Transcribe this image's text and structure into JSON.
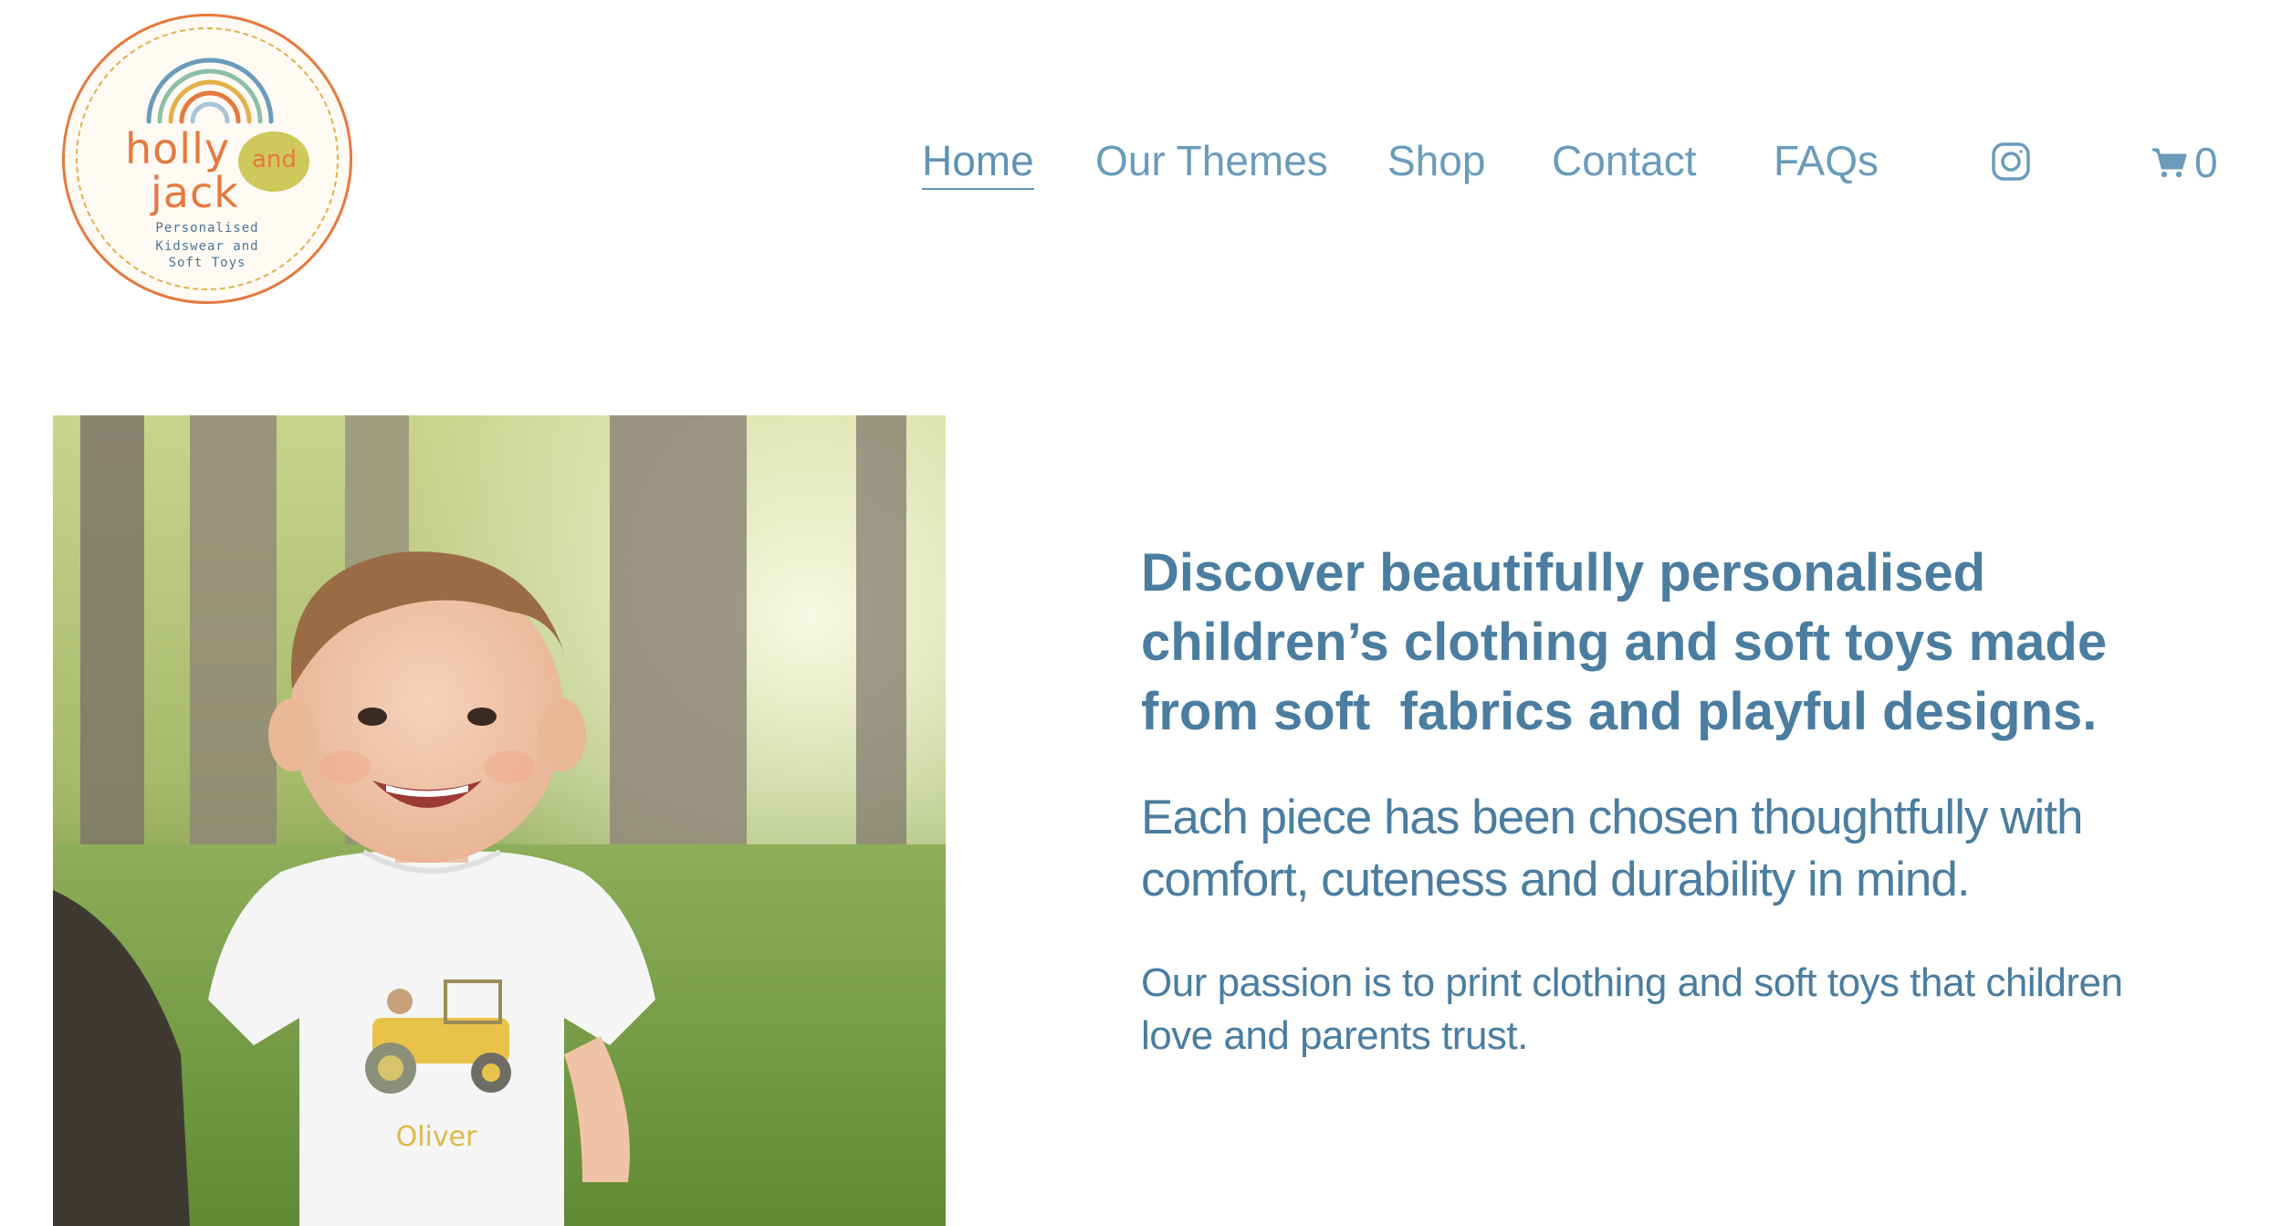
{
  "brand": {
    "logo_words": [
      "holly",
      "and",
      "jack"
    ],
    "logo_tagline": [
      "Personalised",
      "Kidswear and",
      "Soft Toys"
    ],
    "logo_colors": {
      "ring": "#e5793f",
      "dot": "#cfc85a",
      "rainbow": [
        "#e5793f",
        "#e2b04a",
        "#8cbfa7",
        "#6a9bbb"
      ]
    }
  },
  "nav": {
    "items": [
      {
        "label": "Home",
        "active": true
      },
      {
        "label": "Our Themes",
        "active": false
      },
      {
        "label": "Shop",
        "active": false
      },
      {
        "label": "Contact",
        "active": false
      },
      {
        "label": "FAQs",
        "active": false
      }
    ],
    "social_icon": "instagram-icon",
    "cart_icon": "cart-icon",
    "cart_count": "0",
    "color": "#6a9bbb"
  },
  "hero": {
    "image_alt": "Smiling toddler in a white t-shirt printed with a yellow road roller and the name Oliver, in a forest",
    "shirt_name": "Oliver",
    "headline": "Discover beautifully personalised children’s clothing and soft toys made from soft  fabrics and playful designs.",
    "subhead": "Each piece has been chosen thoughtfully with comfort, cuteness and durability in mind.",
    "body": "Our passion is to print clothing and soft toys that children love and parents trust.",
    "text_color": "#4a7da0"
  }
}
